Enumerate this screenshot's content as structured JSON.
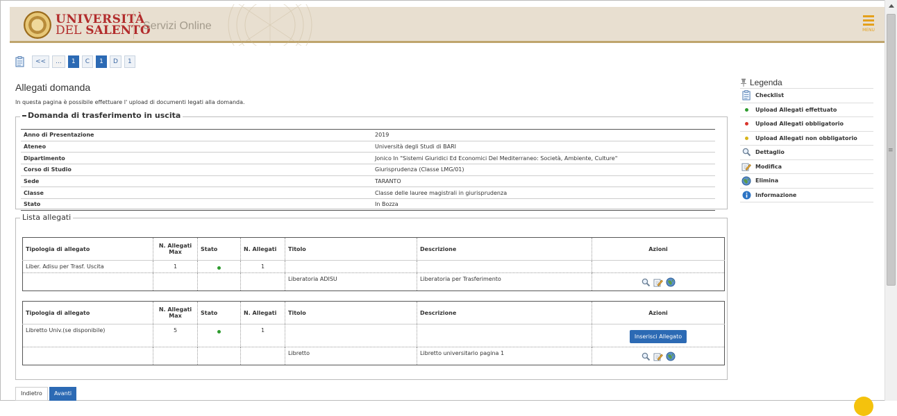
{
  "header": {
    "logo_line1": "UNIVERSITÀ",
    "logo_line2_a": "DEL",
    "logo_line2_b": "SALENTO",
    "service": "Servizi Online",
    "menu_label": "MENU",
    "accent_color": "#e4a01b"
  },
  "breadcrumb": {
    "icon": "checklist-icon",
    "items": [
      "<<",
      "...",
      "1",
      "C",
      "1",
      "D",
      "1"
    ]
  },
  "page": {
    "title": "Allegati domanda",
    "description": "In questa pagina è possibile effettuare l' upload di documenti legati alla domanda."
  },
  "domanda": {
    "legend": "Domanda di trasferimento in uscita",
    "rows": [
      {
        "label": "Anno di Presentazione",
        "value": "2019"
      },
      {
        "label": "Ateneo",
        "value": "Università degli Studi di BARI"
      },
      {
        "label": "Dipartimento",
        "value": "Jonico In \"Sistemi Giuridici Ed Economici Del Mediterraneo: Società, Ambiente, Culture\""
      },
      {
        "label": "Corso di Studio",
        "value": "Giurisprudenza (Classe LMG/01)"
      },
      {
        "label": "Sede",
        "value": "TARANTO"
      },
      {
        "label": "Classe",
        "value": "Classe delle lauree magistrali in giurisprudenza"
      },
      {
        "label": "Stato",
        "value": "In Bozza"
      }
    ]
  },
  "lista": {
    "legend": "Lista allegati",
    "headers": {
      "tipologia": "Tipologia di allegato",
      "max": "N. Allegati Max",
      "stato": "Stato",
      "n": "N. Allegati",
      "titolo": "Titolo",
      "descrizione": "Descrizione",
      "azioni": "Azioni"
    },
    "tables": [
      {
        "tipologia": "Liber. Adisu per Trasf. Uscita",
        "max": "1",
        "n": "1",
        "file_titolo": "Liberatoria ADISU",
        "file_descrizione": "Liberatoria per Trasferimento"
      },
      {
        "tipologia": "Libretto Univ.(se disponibile)",
        "max": "5",
        "n": "1",
        "insert_label": "Inserisci Allegato",
        "file_titolo": "Libretto",
        "file_descrizione": "Libretto universitario pagina 1"
      }
    ]
  },
  "buttons": {
    "back": "Indietro",
    "next": "Avanti"
  },
  "legenda": {
    "title": "Legenda",
    "items": [
      {
        "label": "Checklist",
        "icon": "checklist-icon"
      },
      {
        "label": "Upload Allegati effettuato",
        "icon": "green-dot-icon",
        "color": "#2e9b2e"
      },
      {
        "label": "Upload Allegati obbligatorio",
        "icon": "red-dot-icon",
        "color": "#d9342b"
      },
      {
        "label": "Upload Allegati non obbligatorio",
        "icon": "yellow-dot-icon",
        "color": "#d8b41a"
      },
      {
        "label": "Dettaglio",
        "icon": "magnifier-icon"
      },
      {
        "label": "Modifica",
        "icon": "edit-icon"
      },
      {
        "label": "Elimina",
        "icon": "delete-icon"
      },
      {
        "label": "Informazione",
        "icon": "info-icon"
      }
    ]
  }
}
